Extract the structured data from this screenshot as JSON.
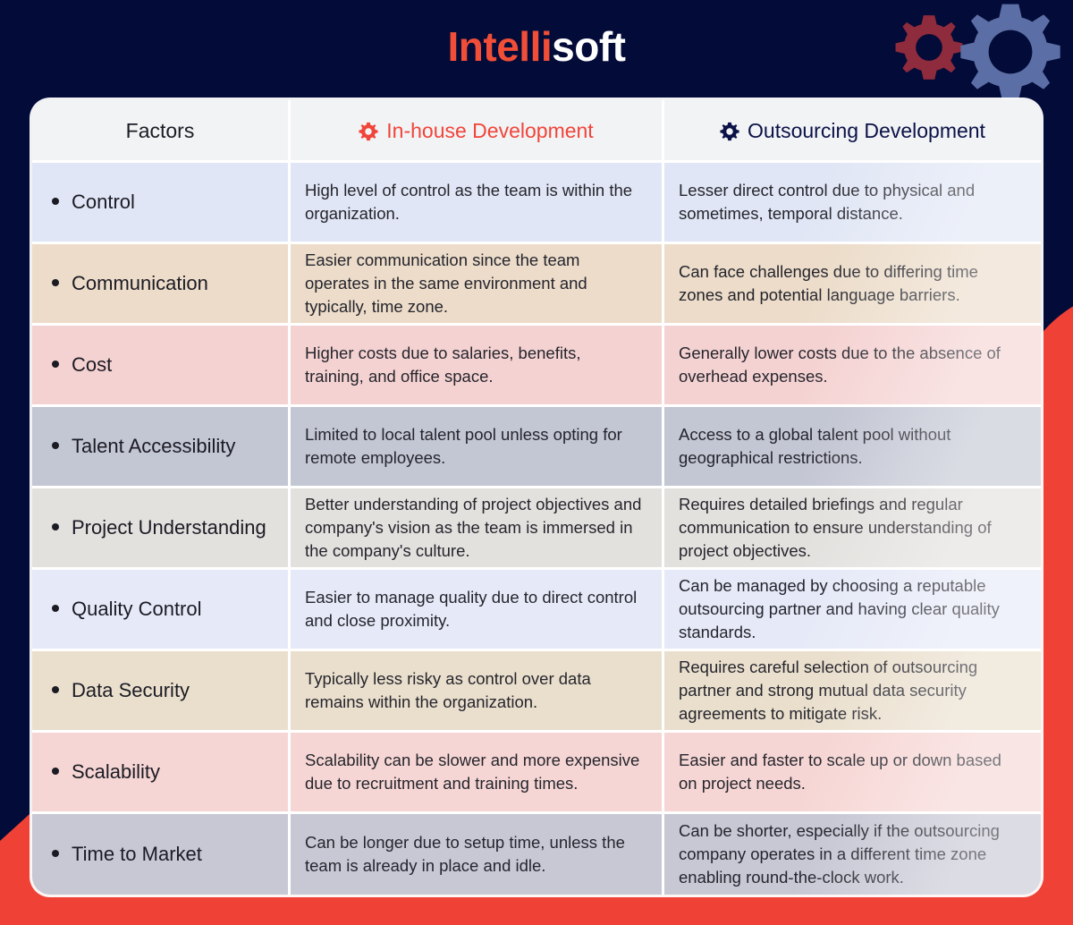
{
  "brand": {
    "logo_part_one": "Intelli",
    "logo_part_two": "soft",
    "gear_small_color": "#8e2b3c",
    "gear_large_color": "#5b6ea5",
    "background_color": "#030b38",
    "accent_red": "#ef4136"
  },
  "table": {
    "headers": {
      "factors": "Factors",
      "inhouse": "In-house Development",
      "outsourcing": "Outsourcing Development",
      "inhouse_icon": "gear-icon",
      "outsourcing_icon": "gear-icon",
      "inhouse_color": "#f0453a",
      "outsourcing_color": "#0b1247"
    },
    "rows": [
      {
        "factor": "Control",
        "inhouse": "High level of control as the team is within the organization.",
        "outsourcing": "Lesser direct control due to physical and sometimes, temporal distance.",
        "tint": "tint-blue"
      },
      {
        "factor": "Communication",
        "inhouse": "Easier communication since the team operates in the same environment and typically, time zone.",
        "outsourcing": "Can face challenges due to differing time zones and potential language barriers.",
        "tint": "tint-beige"
      },
      {
        "factor": "Cost",
        "inhouse": "Higher costs due to salaries, benefits, training, and office space.",
        "outsourcing": "Generally lower costs due to the absence of overhead expenses.",
        "tint": "tint-pink"
      },
      {
        "factor": "Talent Accessibility",
        "inhouse": "Limited to local talent pool unless opting for remote employees.",
        "outsourcing": "Access to a global talent pool without geographical restrictions.",
        "tint": "tint-gray"
      },
      {
        "factor": "Project Understanding",
        "inhouse": "Better understanding of project objectives and company's vision as the team is immersed in the company's culture.",
        "outsourcing": "Requires detailed briefings and regular communication to ensure understanding of project objectives.",
        "tint": "tint-lgray"
      },
      {
        "factor": "Quality Control",
        "inhouse": "Easier to manage quality due to direct control and close proximity.",
        "outsourcing": "Can be managed by choosing a reputable outsourcing partner and having clear quality standards.",
        "tint": "tint-lblue"
      },
      {
        "factor": "Data Security",
        "inhouse": "Typically less risky as control over data remains within the organization.",
        "outsourcing": "Requires careful selection of outsourcing partner and strong mutual data security agreements to mitigate risk.",
        "tint": "tint-beige2"
      },
      {
        "factor": "Scalability",
        "inhouse": "Scalability can be slower and more expensive due to recruitment and training times.",
        "outsourcing": "Easier and faster to scale up or down based on project needs.",
        "tint": "tint-pink2"
      },
      {
        "factor": "Time to Market",
        "inhouse": "Can be longer due to setup time, unless the team is already in place and idle.",
        "outsourcing": "Can be shorter, especially if the outsourcing company operates in a different time zone enabling round-the-clock work.",
        "tint": "tint-gray2"
      }
    ]
  }
}
